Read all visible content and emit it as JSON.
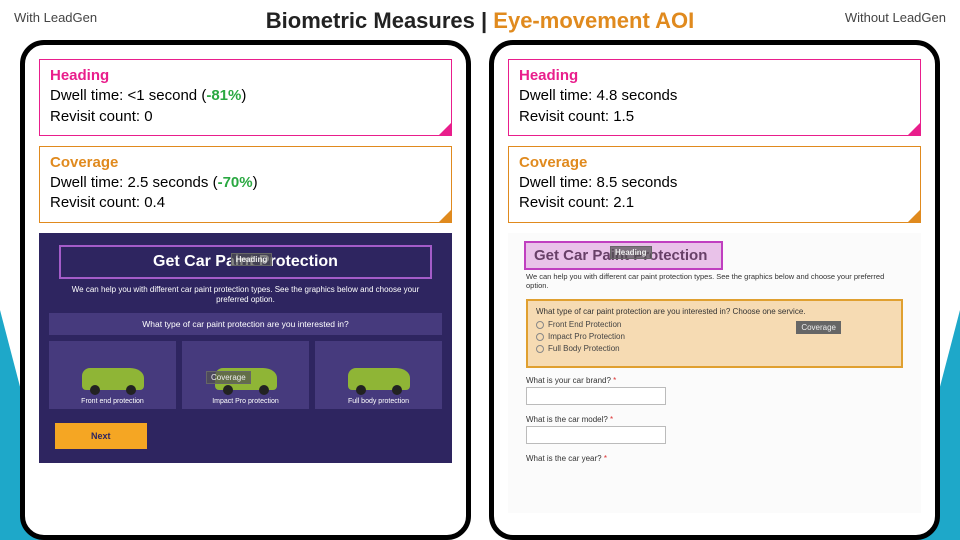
{
  "labels": {
    "left": "With LeadGen",
    "right": "Without LeadGen"
  },
  "title": {
    "main": "Biometric Measures",
    "sep": " | ",
    "accent": "Eye-movement AOI"
  },
  "left": {
    "heading": {
      "title": "Heading",
      "dwell_pre": "Dwell time: <1 second (",
      "delta": "-81%",
      "dwell_post": ")",
      "revisit": "Revisit count: 0"
    },
    "coverage": {
      "title": "Coverage",
      "dwell_pre": "Dwell time: 2.5 seconds (",
      "delta": "-70%",
      "dwell_post": ")",
      "revisit": "Revisit count: 0.4"
    },
    "mock": {
      "h2": "Get Car Paint Protection",
      "aoi_heading_tag": "Heading",
      "sub": "We can help you with different car paint protection types. See the graphics below and choose your preferred option.",
      "q": "What type of car paint protection are you interested in?",
      "cards": [
        "Front end protection",
        "Impact Pro protection",
        "Full body protection"
      ],
      "aoi_coverage_tag": "Coverage",
      "next": "Next"
    }
  },
  "right": {
    "heading": {
      "title": "Heading",
      "dwell": "Dwell time: 4.8 seconds",
      "revisit": "Revisit count: 1.5"
    },
    "coverage": {
      "title": "Coverage",
      "dwell": "Dwell time: 8.5 seconds",
      "revisit": "Revisit count: 2.1"
    },
    "mock": {
      "h2": "Get Car Paint Protection",
      "aoi_heading_tag": "Heading",
      "sub": "We can help you with different car paint protection types. See the graphics below and choose your preferred option.",
      "q": "What type of car paint protection are you interested in? Choose one service.",
      "options": [
        "Front End Protection",
        "Impact Pro Protection",
        "Full Body Protection"
      ],
      "aoi_coverage_tag": "Coverage",
      "q_brand": "What is your car brand?",
      "q_model": "What is the car model?",
      "q_year": "What is the car year?",
      "req": "*"
    }
  }
}
